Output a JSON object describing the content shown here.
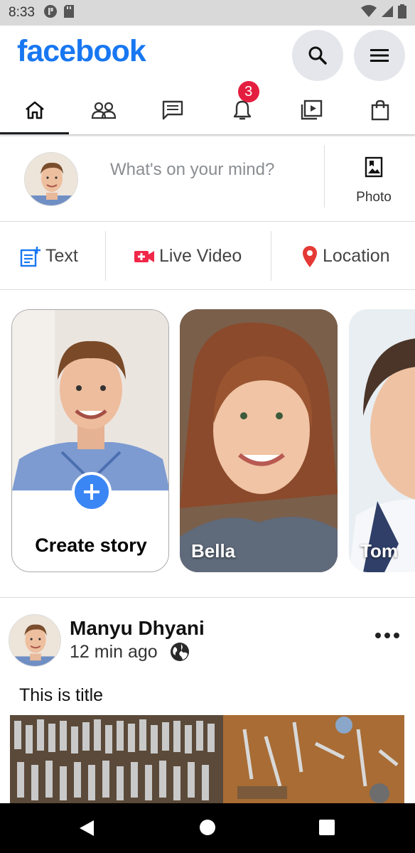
{
  "status_bar": {
    "time": "8:33"
  },
  "header": {
    "logo": "facebook"
  },
  "nav": {
    "tabs": [
      {
        "name": "home",
        "active": true
      },
      {
        "name": "friends",
        "active": false
      },
      {
        "name": "messages",
        "active": false
      },
      {
        "name": "notifications",
        "active": false,
        "badge": "3"
      },
      {
        "name": "watch",
        "active": false
      },
      {
        "name": "marketplace",
        "active": false
      }
    ]
  },
  "composer": {
    "placeholder": "What's on your mind?",
    "photo_label": "Photo"
  },
  "actions": {
    "text": "Text",
    "live_video": "Live Video",
    "location": "Location"
  },
  "stories": {
    "create_label": "Create story",
    "items": [
      {
        "name": "Bella"
      },
      {
        "name": "Tom"
      }
    ]
  },
  "post": {
    "author": "Manyu Dhyani",
    "time": "12 min ago",
    "title": "This is title"
  },
  "colors": {
    "brand": "#1877f2",
    "badge": "#e41e3f",
    "live": "#f02849",
    "location": "#e53935"
  }
}
